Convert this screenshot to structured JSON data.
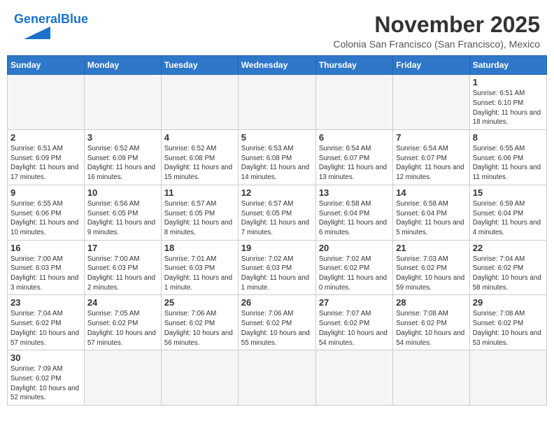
{
  "header": {
    "logo_general": "General",
    "logo_blue": "Blue",
    "month_year": "November 2025",
    "location": "Colonia San Francisco (San Francisco), Mexico"
  },
  "days_of_week": [
    "Sunday",
    "Monday",
    "Tuesday",
    "Wednesday",
    "Thursday",
    "Friday",
    "Saturday"
  ],
  "weeks": [
    [
      {
        "day": "",
        "info": ""
      },
      {
        "day": "",
        "info": ""
      },
      {
        "day": "",
        "info": ""
      },
      {
        "day": "",
        "info": ""
      },
      {
        "day": "",
        "info": ""
      },
      {
        "day": "",
        "info": ""
      },
      {
        "day": "1",
        "info": "Sunrise: 6:51 AM\nSunset: 6:10 PM\nDaylight: 11 hours and 18 minutes."
      }
    ],
    [
      {
        "day": "2",
        "info": "Sunrise: 6:51 AM\nSunset: 6:09 PM\nDaylight: 11 hours and 17 minutes."
      },
      {
        "day": "3",
        "info": "Sunrise: 6:52 AM\nSunset: 6:09 PM\nDaylight: 11 hours and 16 minutes."
      },
      {
        "day": "4",
        "info": "Sunrise: 6:52 AM\nSunset: 6:08 PM\nDaylight: 11 hours and 15 minutes."
      },
      {
        "day": "5",
        "info": "Sunrise: 6:53 AM\nSunset: 6:08 PM\nDaylight: 11 hours and 14 minutes."
      },
      {
        "day": "6",
        "info": "Sunrise: 6:54 AM\nSunset: 6:07 PM\nDaylight: 11 hours and 13 minutes."
      },
      {
        "day": "7",
        "info": "Sunrise: 6:54 AM\nSunset: 6:07 PM\nDaylight: 11 hours and 12 minutes."
      },
      {
        "day": "8",
        "info": "Sunrise: 6:55 AM\nSunset: 6:06 PM\nDaylight: 11 hours and 11 minutes."
      }
    ],
    [
      {
        "day": "9",
        "info": "Sunrise: 6:55 AM\nSunset: 6:06 PM\nDaylight: 11 hours and 10 minutes."
      },
      {
        "day": "10",
        "info": "Sunrise: 6:56 AM\nSunset: 6:05 PM\nDaylight: 11 hours and 9 minutes."
      },
      {
        "day": "11",
        "info": "Sunrise: 6:57 AM\nSunset: 6:05 PM\nDaylight: 11 hours and 8 minutes."
      },
      {
        "day": "12",
        "info": "Sunrise: 6:57 AM\nSunset: 6:05 PM\nDaylight: 11 hours and 7 minutes."
      },
      {
        "day": "13",
        "info": "Sunrise: 6:58 AM\nSunset: 6:04 PM\nDaylight: 11 hours and 6 minutes."
      },
      {
        "day": "14",
        "info": "Sunrise: 6:58 AM\nSunset: 6:04 PM\nDaylight: 11 hours and 5 minutes."
      },
      {
        "day": "15",
        "info": "Sunrise: 6:59 AM\nSunset: 6:04 PM\nDaylight: 11 hours and 4 minutes."
      }
    ],
    [
      {
        "day": "16",
        "info": "Sunrise: 7:00 AM\nSunset: 6:03 PM\nDaylight: 11 hours and 3 minutes."
      },
      {
        "day": "17",
        "info": "Sunrise: 7:00 AM\nSunset: 6:03 PM\nDaylight: 11 hours and 2 minutes."
      },
      {
        "day": "18",
        "info": "Sunrise: 7:01 AM\nSunset: 6:03 PM\nDaylight: 11 hours and 1 minute."
      },
      {
        "day": "19",
        "info": "Sunrise: 7:02 AM\nSunset: 6:03 PM\nDaylight: 11 hours and 1 minute."
      },
      {
        "day": "20",
        "info": "Sunrise: 7:02 AM\nSunset: 6:02 PM\nDaylight: 11 hours and 0 minutes."
      },
      {
        "day": "21",
        "info": "Sunrise: 7:03 AM\nSunset: 6:02 PM\nDaylight: 10 hours and 59 minutes."
      },
      {
        "day": "22",
        "info": "Sunrise: 7:04 AM\nSunset: 6:02 PM\nDaylight: 10 hours and 58 minutes."
      }
    ],
    [
      {
        "day": "23",
        "info": "Sunrise: 7:04 AM\nSunset: 6:02 PM\nDaylight: 10 hours and 57 minutes."
      },
      {
        "day": "24",
        "info": "Sunrise: 7:05 AM\nSunset: 6:02 PM\nDaylight: 10 hours and 57 minutes."
      },
      {
        "day": "25",
        "info": "Sunrise: 7:06 AM\nSunset: 6:02 PM\nDaylight: 10 hours and 56 minutes."
      },
      {
        "day": "26",
        "info": "Sunrise: 7:06 AM\nSunset: 6:02 PM\nDaylight: 10 hours and 55 minutes."
      },
      {
        "day": "27",
        "info": "Sunrise: 7:07 AM\nSunset: 6:02 PM\nDaylight: 10 hours and 54 minutes."
      },
      {
        "day": "28",
        "info": "Sunrise: 7:08 AM\nSunset: 6:02 PM\nDaylight: 10 hours and 54 minutes."
      },
      {
        "day": "29",
        "info": "Sunrise: 7:08 AM\nSunset: 6:02 PM\nDaylight: 10 hours and 53 minutes."
      }
    ],
    [
      {
        "day": "30",
        "info": "Sunrise: 7:09 AM\nSunset: 6:02 PM\nDaylight: 10 hours and 52 minutes."
      },
      {
        "day": "",
        "info": ""
      },
      {
        "day": "",
        "info": ""
      },
      {
        "day": "",
        "info": ""
      },
      {
        "day": "",
        "info": ""
      },
      {
        "day": "",
        "info": ""
      },
      {
        "day": "",
        "info": ""
      }
    ]
  ]
}
